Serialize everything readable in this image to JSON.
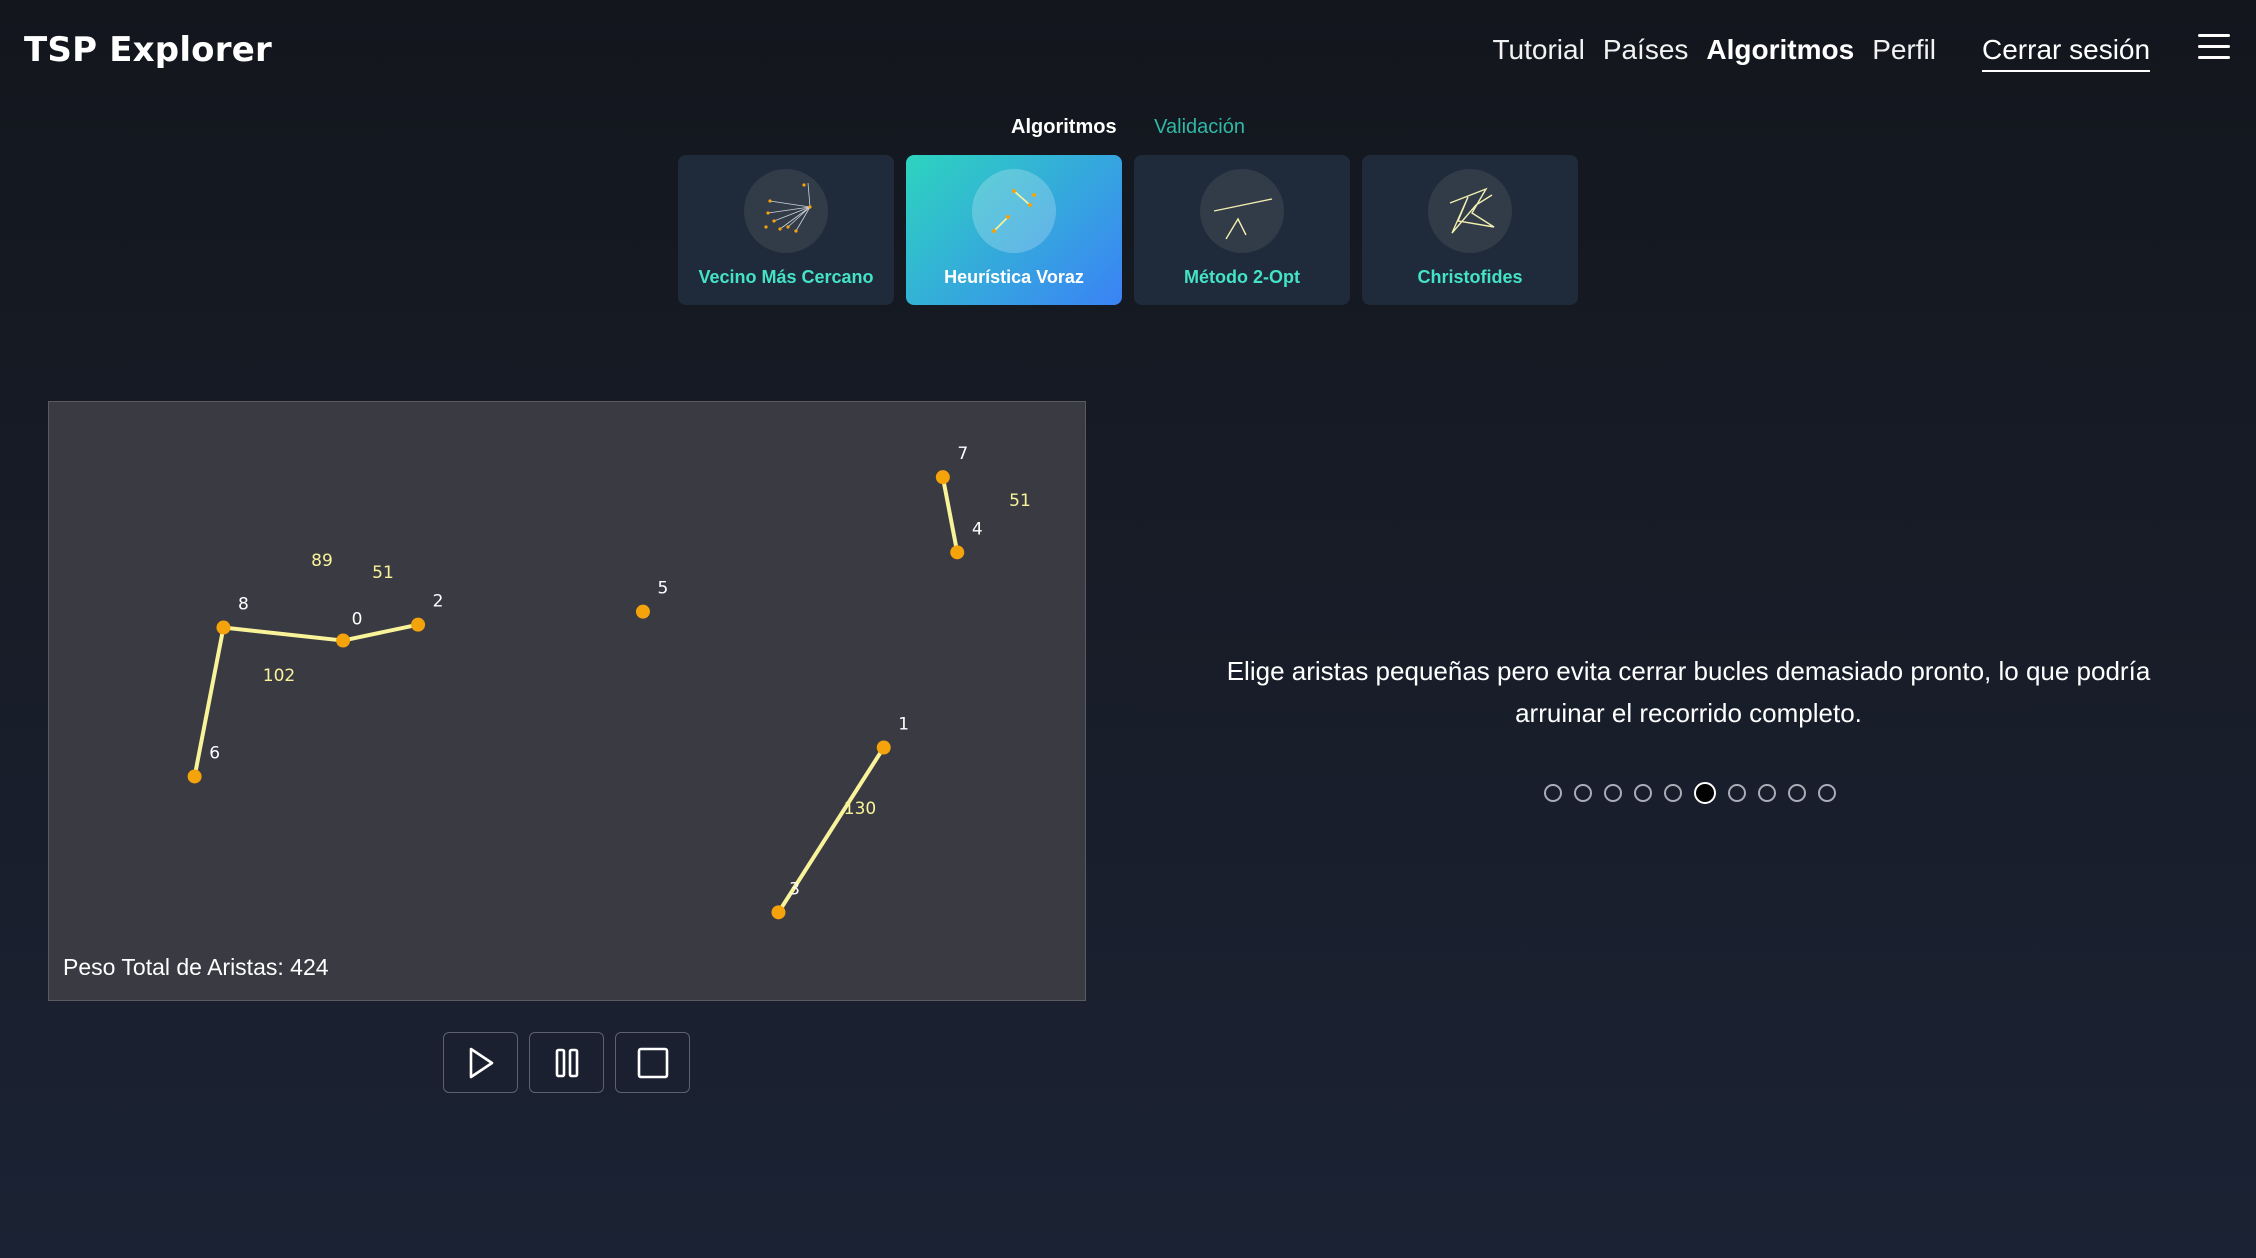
{
  "header": {
    "brand": "TSP Explorer",
    "nav": [
      "Tutorial",
      "Países",
      "Algoritmos",
      "Perfil"
    ],
    "active_nav": "Algoritmos",
    "logout": "Cerrar sesión",
    "menu_icon": "hamburger-icon"
  },
  "subtabs": {
    "algorithms": "Algoritmos",
    "validation": "Validación"
  },
  "algorithms": [
    {
      "label": "Vecino Más Cercano",
      "icon": "nearest-neighbor-thumbnail",
      "selected": false
    },
    {
      "label": "Heurística Voraz",
      "icon": "greedy-heuristic-thumbnail",
      "selected": true
    },
    {
      "label": "Método 2-Opt",
      "icon": "two-opt-thumbnail",
      "selected": false
    },
    {
      "label": "Christofides",
      "icon": "christofides-thumbnail",
      "selected": false
    }
  ],
  "graph": {
    "nodes": [
      {
        "id": "0"
      },
      {
        "id": "1"
      },
      {
        "id": "2"
      },
      {
        "id": "3"
      },
      {
        "id": "4"
      },
      {
        "id": "5"
      },
      {
        "id": "6"
      },
      {
        "id": "7"
      },
      {
        "id": "8"
      }
    ],
    "edges": [
      {
        "from": "0",
        "to": "2",
        "weight": "51"
      },
      {
        "from": "8",
        "to": "0",
        "weight": "89"
      },
      {
        "from": "8",
        "to": "6",
        "weight": "102"
      },
      {
        "from": "7",
        "to": "4",
        "weight": "51"
      },
      {
        "from": "1",
        "to": "3",
        "weight": "130"
      }
    ],
    "total_weight_label": "Peso Total de Aristas: 424",
    "colors": {
      "node": "#f5a30b",
      "edge": "#f9f39a",
      "background": "#393a42"
    }
  },
  "controls": {
    "play": "play-icon",
    "pause": "pause-icon",
    "stop": "stop-icon"
  },
  "description": "Elige aristas pequeñas pero evita cerrar bucles demasiado pronto, lo que podría arruinar el recorrido completo.",
  "pagination": {
    "total": 10,
    "current": 6
  }
}
